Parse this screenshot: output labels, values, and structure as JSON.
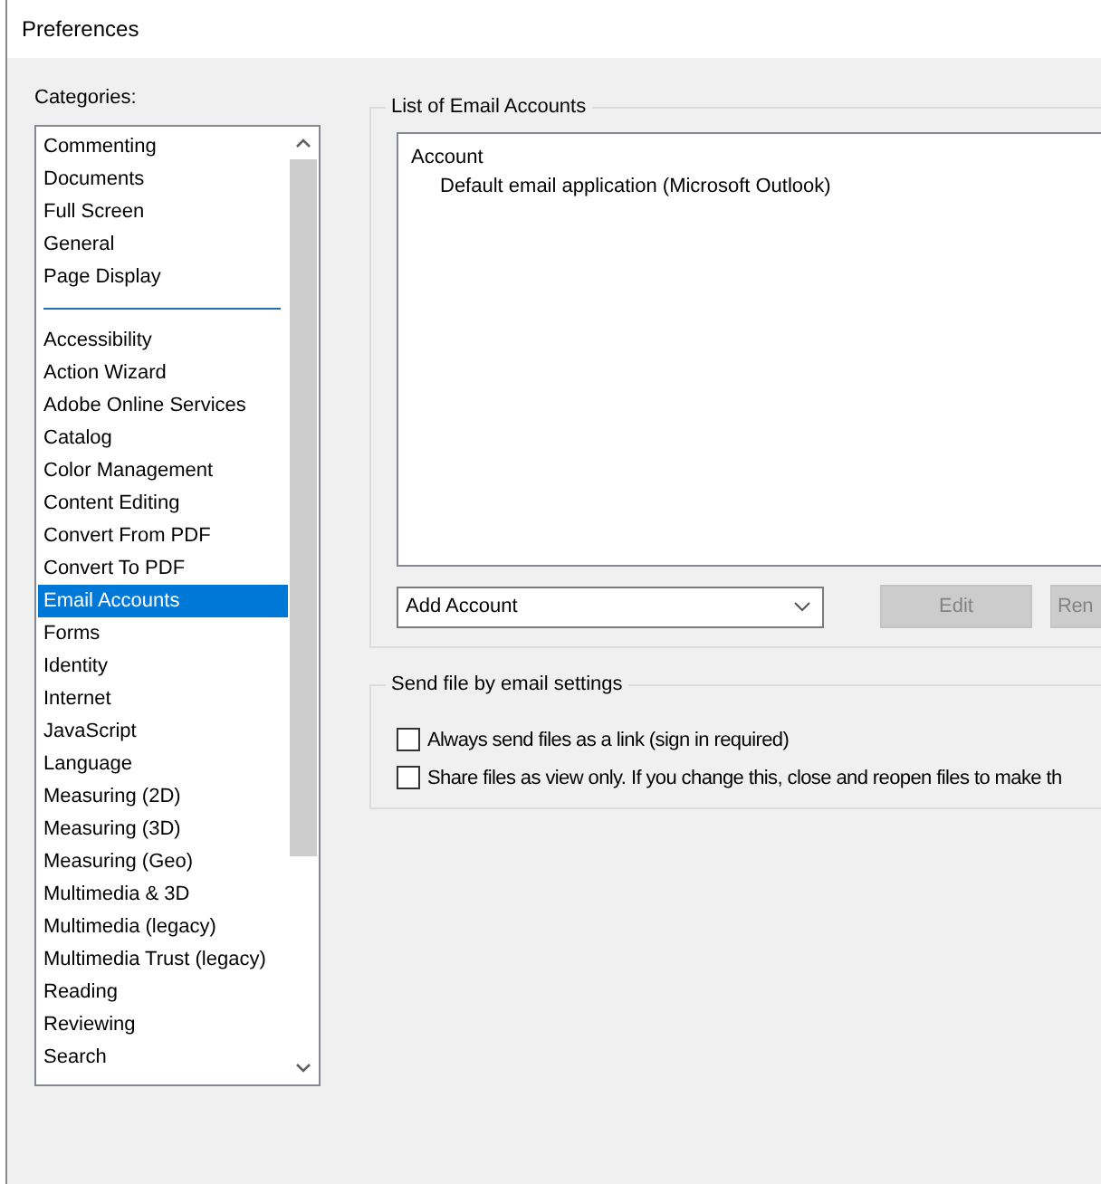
{
  "window": {
    "title": "Preferences"
  },
  "categories": {
    "label": "Categories:",
    "groups": [
      {
        "items": [
          {
            "label": "Commenting",
            "selected": false
          },
          {
            "label": "Documents",
            "selected": false
          },
          {
            "label": "Full Screen",
            "selected": false
          },
          {
            "label": "General",
            "selected": false
          },
          {
            "label": "Page Display",
            "selected": false
          }
        ]
      },
      {
        "items": [
          {
            "label": "Accessibility",
            "selected": false
          },
          {
            "label": "Action Wizard",
            "selected": false
          },
          {
            "label": "Adobe Online Services",
            "selected": false
          },
          {
            "label": "Catalog",
            "selected": false
          },
          {
            "label": "Color Management",
            "selected": false
          },
          {
            "label": "Content Editing",
            "selected": false
          },
          {
            "label": "Convert From PDF",
            "selected": false
          },
          {
            "label": "Convert To PDF",
            "selected": false
          },
          {
            "label": "Email Accounts",
            "selected": true
          },
          {
            "label": "Forms",
            "selected": false
          },
          {
            "label": "Identity",
            "selected": false
          },
          {
            "label": "Internet",
            "selected": false
          },
          {
            "label": "JavaScript",
            "selected": false
          },
          {
            "label": "Language",
            "selected": false
          },
          {
            "label": "Measuring (2D)",
            "selected": false
          },
          {
            "label": "Measuring (3D)",
            "selected": false
          },
          {
            "label": "Measuring (Geo)",
            "selected": false
          },
          {
            "label": "Multimedia & 3D",
            "selected": false
          },
          {
            "label": "Multimedia (legacy)",
            "selected": false
          },
          {
            "label": "Multimedia Trust (legacy)",
            "selected": false
          },
          {
            "label": "Reading",
            "selected": false
          },
          {
            "label": "Reviewing",
            "selected": false
          },
          {
            "label": "Search",
            "selected": false
          }
        ]
      }
    ]
  },
  "accounts": {
    "title": "List of Email Accounts",
    "header": "Account",
    "rows": [
      "Default email application (Microsoft Outlook)"
    ],
    "dropdown": {
      "value": "Add Account"
    },
    "buttons": [
      {
        "label": "Edit",
        "disabled": true
      },
      {
        "label": "Ren",
        "disabled": true
      }
    ]
  },
  "send_settings": {
    "title": "Send file by email settings",
    "options": [
      {
        "label": "Always send files as a link (sign in required)",
        "checked": false
      },
      {
        "label": "Share files as view only. If you change this, close and reopen files to make th",
        "checked": false
      }
    ]
  }
}
